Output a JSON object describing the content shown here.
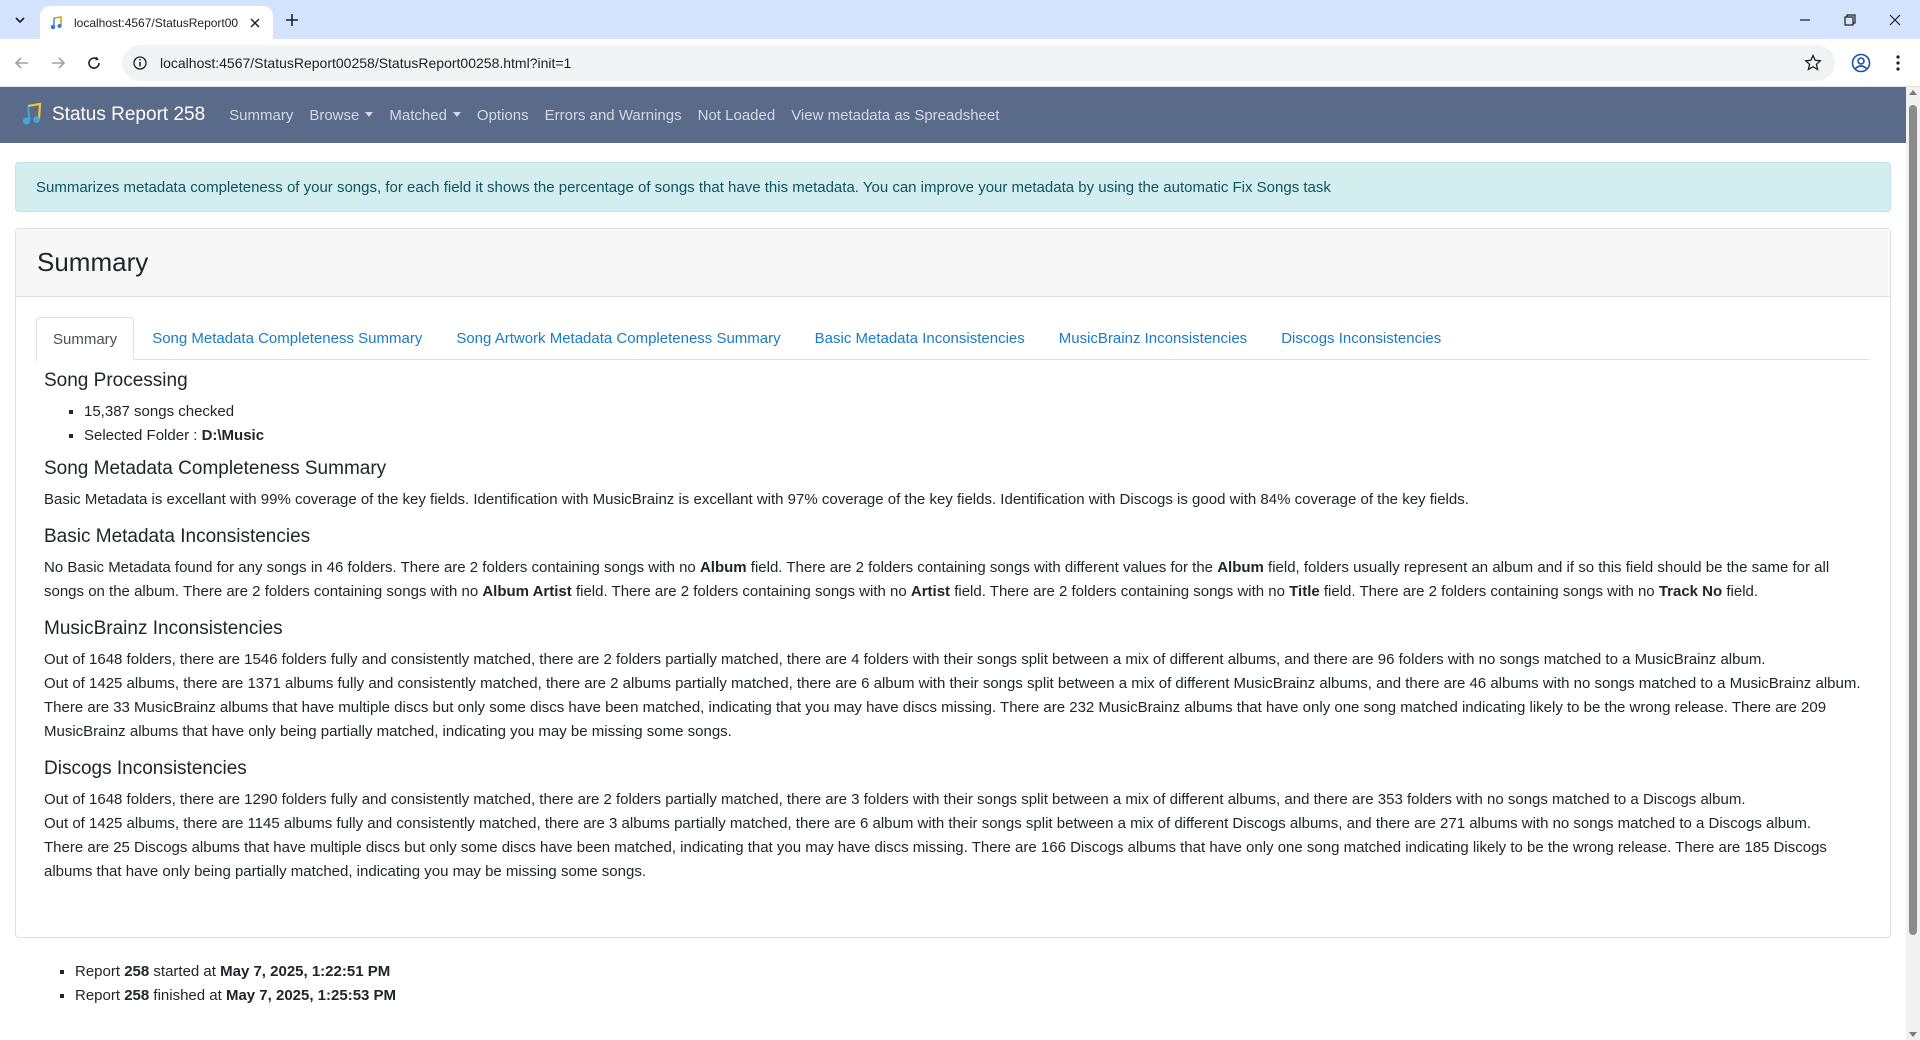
{
  "browser": {
    "tab_title": "localhost:4567/StatusReport00",
    "url": "localhost:4567/StatusReport00258/StatusReport00258.html?init=1"
  },
  "navbar": {
    "brand": "Status Report 258",
    "links": {
      "summary": "Summary",
      "browse": "Browse",
      "matched": "Matched",
      "options": "Options",
      "errors": "Errors and Warnings",
      "not_loaded": "Not Loaded",
      "spreadsheet": "View metadata as Spreadsheet"
    }
  },
  "alert": "Summarizes metadata completeness of your songs, for each field it shows the percentage of songs that have this metadata. You can improve your metadata by using the automatic Fix Songs task",
  "card": {
    "title": "Summary",
    "tabs": {
      "summary": "Summary",
      "song_metadata": "Song Metadata Completeness Summary",
      "song_artwork": "Song Artwork Metadata Completeness Summary",
      "basic_inconsistencies": "Basic Metadata Inconsistencies",
      "musicbrainz": "MusicBrainz Inconsistencies",
      "discogs": "Discogs Inconsistencies"
    }
  },
  "song_processing": {
    "title": "Song Processing",
    "songs_checked": "15,387 songs checked",
    "folder_label": "Selected Folder : ",
    "folder_value": "D:\\Music"
  },
  "metadata_summary": {
    "title": "Song Metadata Completeness Summary",
    "text": "Basic Metadata is excellant with 99% coverage of the key fields. Identification with MusicBrainz is excellant with 97% coverage of the key fields. Identification with Discogs is good with 84% coverage of the key fields."
  },
  "basic_inconsistencies": {
    "title": "Basic Metadata Inconsistencies",
    "t1": "No Basic Metadata found for any songs in 46 folders. There are 2 folders containing songs with no ",
    "b1": "Album",
    "t2": " field. There are 2 folders containing songs with different values for the ",
    "b2": "Album",
    "t3": " field, folders usually represent an album and if so this field should be the same for all songs on the album. There are 2 folders containing songs with no ",
    "b3": "Album Artist",
    "t4": " field. There are 2 folders containing songs with no ",
    "b4": "Artist",
    "t5": " field. There are 2 folders containing songs with no ",
    "b5": "Title",
    "t6": " field. There are 2 folders containing songs with no ",
    "b6": "Track No",
    "t7": " field."
  },
  "musicbrainz": {
    "title": "MusicBrainz Inconsistencies",
    "line1": "Out of 1648 folders, there are 1546 folders fully and consistently matched, there are 2 folders partially matched, there are 4 folders with their songs split between a mix of different albums, and there are 96 folders with no songs matched to a MusicBrainz album.",
    "line2": "Out of 1425 albums, there are 1371 albums fully and consistently matched, there are 2 albums partially matched, there are 6 album with their songs split between a mix of different MusicBrainz albums, and there are 46 albums with no songs matched to a MusicBrainz album.",
    "line3": "There are 33 MusicBrainz albums that have multiple discs but only some discs have been matched, indicating that you may have discs missing. There are 232 MusicBrainz albums that have only one song matched indicating likely to be the wrong release. There are 209 MusicBrainz albums that have only being partially matched, indicating you may be missing some songs."
  },
  "discogs": {
    "title": "Discogs Inconsistencies",
    "line1": "Out of 1648 folders, there are 1290 folders fully and consistently matched, there are 2 folders partially matched, there are 3 folders with their songs split between a mix of different albums, and there are 353 folders with no songs matched to a Discogs album.",
    "line2": "Out of 1425 albums, there are 1145 albums fully and consistently matched, there are 3 albums partially matched, there are 6 album with their songs split between a mix of different Discogs albums, and there are 271 albums with no songs matched to a Discogs album.",
    "line3": "There are 25 Discogs albums that have multiple discs but only some discs have been matched, indicating that you may have discs missing. There are 166 Discogs albums that have only one song matched indicating likely to be the wrong release. There are 185 Discogs albums that have only being partially matched, indicating you may be missing some songs."
  },
  "footer": {
    "report_label": "Report ",
    "report_number": "258",
    "started_label": " started at ",
    "started_time": "May 7, 2025, 1:22:51 PM",
    "finished_label": " finished at ",
    "finished_time": "May 7, 2025, 1:25:53 PM"
  },
  "colors": {
    "navbar_bg": "#5a6b89",
    "alert_bg": "#d4edef",
    "link": "#1a7bc8",
    "tabstrip": "#d3e3fd"
  }
}
